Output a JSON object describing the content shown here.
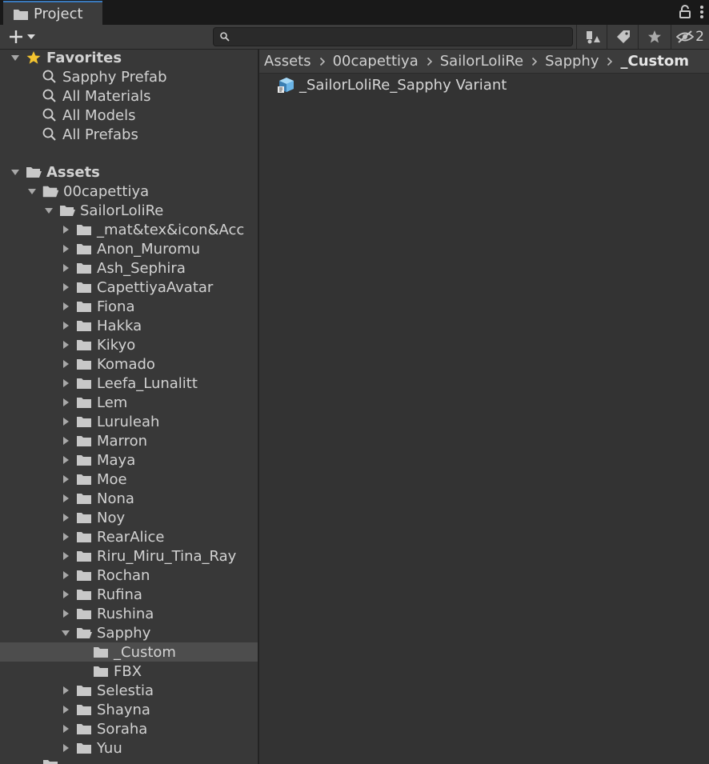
{
  "window": {
    "tab_title": "Project",
    "tab_icon": "folder-icon"
  },
  "toolbar": {
    "create_icon": "plus-icon",
    "search": {
      "value": "",
      "placeholder": ""
    },
    "hidden_count": "2"
  },
  "favorites": {
    "label": "Favorites",
    "items": [
      {
        "label": "Sapphy Prefab"
      },
      {
        "label": "All Materials"
      },
      {
        "label": "All Models"
      },
      {
        "label": "All Prefabs"
      }
    ]
  },
  "assets": {
    "label": "Assets",
    "root_folder": "00capettiya",
    "sub_folder": "SailorLoliRe",
    "folders": [
      {
        "label": "_mat&tex&icon&Acc"
      },
      {
        "label": "Anon_Muromu"
      },
      {
        "label": "Ash_Sephira"
      },
      {
        "label": "CapettiyaAvatar"
      },
      {
        "label": "Fiona"
      },
      {
        "label": "Hakka"
      },
      {
        "label": "Kikyo"
      },
      {
        "label": "Komado"
      },
      {
        "label": "Leefa_Lunalitt"
      },
      {
        "label": "Lem"
      },
      {
        "label": "Luruleah"
      },
      {
        "label": "Marron"
      },
      {
        "label": "Maya"
      },
      {
        "label": "Moe"
      },
      {
        "label": "Nona"
      },
      {
        "label": "Noy"
      },
      {
        "label": "RearAlice"
      },
      {
        "label": "Riru_Miru_Tina_Ray"
      },
      {
        "label": "Rochan"
      },
      {
        "label": "Rufina"
      },
      {
        "label": "Rushina"
      }
    ],
    "expanded_folder": "Sapphy",
    "expanded_children": [
      {
        "label": "_Custom",
        "selected": true
      },
      {
        "label": "FBX",
        "selected": false
      }
    ],
    "after_folders": [
      {
        "label": "Selestia"
      },
      {
        "label": "Shayna"
      },
      {
        "label": "Soraha"
      },
      {
        "label": "Yuu"
      }
    ]
  },
  "breadcrumb": [
    {
      "label": "Assets"
    },
    {
      "label": "00capettiya"
    },
    {
      "label": "SailorLoliRe"
    },
    {
      "label": "Sapphy"
    },
    {
      "label": "_Custom"
    }
  ],
  "content": {
    "items": [
      {
        "label": "_SailorLoliRe_Sapphy Variant",
        "icon": "prefab-variant-icon"
      }
    ]
  },
  "colors": {
    "accent_tab": "#3a79bb",
    "favorites_star": "#f4c430",
    "prefab_icon": "#6ab4e6",
    "selection": "#4d4d4d"
  }
}
